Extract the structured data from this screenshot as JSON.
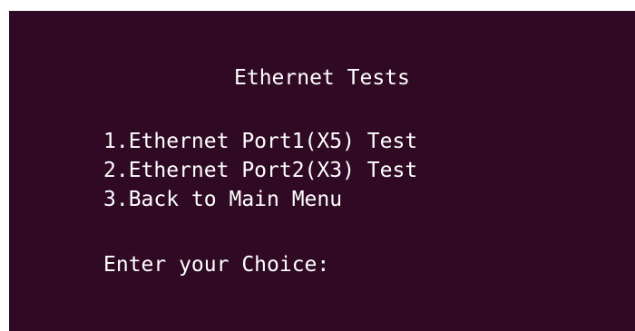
{
  "terminal": {
    "background": "#300a24",
    "foreground": "#ffffff",
    "title": "Ethernet Tests",
    "menu_items": [
      "1.Ethernet Port1(X5) Test",
      "2.Ethernet Port2(X3) Test",
      "3.Back to Main Menu"
    ],
    "prompt": "Enter your Choice:"
  }
}
